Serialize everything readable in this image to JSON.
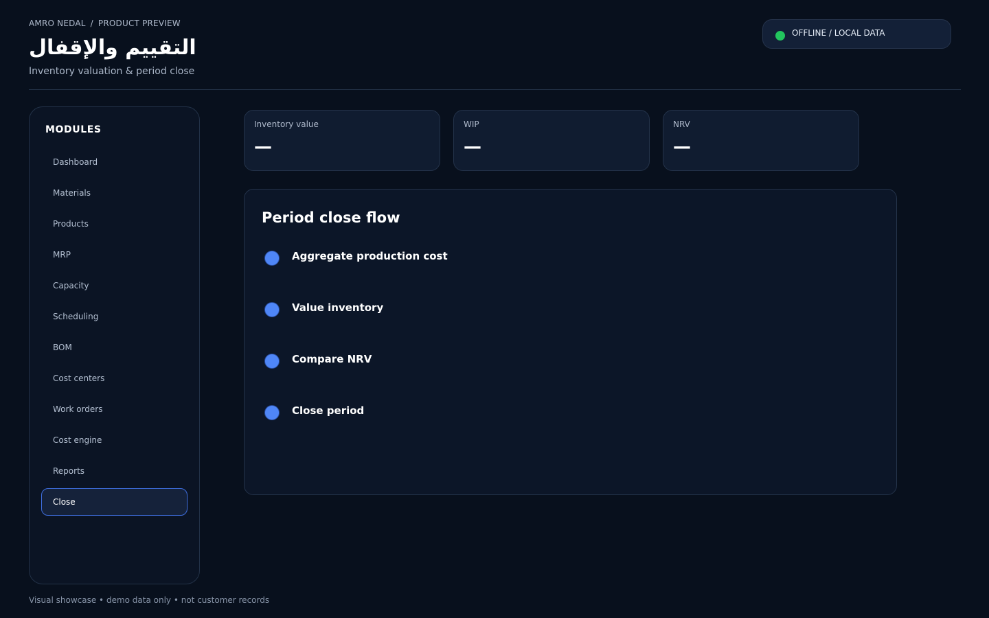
{
  "header": {
    "breadcrumb": [
      "AMRO NEDAL",
      "/",
      "PRODUCT PREVIEW"
    ],
    "title": "التقييم والإقفال",
    "subtitle": "Inventory valuation & period close",
    "status": {
      "label": "OFFLINE / LOCAL DATA",
      "color": "#22c55e"
    }
  },
  "sidebar": {
    "heading": "MODULES",
    "items": [
      {
        "label": "Dashboard",
        "active": false
      },
      {
        "label": "Materials",
        "active": false
      },
      {
        "label": "Products",
        "active": false
      },
      {
        "label": "MRP",
        "active": false
      },
      {
        "label": "Capacity",
        "active": false
      },
      {
        "label": "Scheduling",
        "active": false
      },
      {
        "label": "BOM",
        "active": false
      },
      {
        "label": "Cost centers",
        "active": false
      },
      {
        "label": "Work orders",
        "active": false
      },
      {
        "label": "Cost engine",
        "active": false
      },
      {
        "label": "Reports",
        "active": false
      },
      {
        "label": "Close",
        "active": true
      }
    ]
  },
  "kpis": [
    {
      "label": "Inventory value",
      "value": "—"
    },
    {
      "label": "WIP",
      "value": "—"
    },
    {
      "label": "NRV",
      "value": "—"
    }
  ],
  "flow": {
    "title": "Period close flow",
    "steps": [
      {
        "label": "Aggregate production cost"
      },
      {
        "label": "Value inventory"
      },
      {
        "label": "Compare NRV"
      },
      {
        "label": "Close period"
      }
    ]
  },
  "footer": {
    "note": "Visual showcase • demo data only • not customer records"
  },
  "colors": {
    "accent": "#4f86f7",
    "background": "#08101d",
    "active_border": "#3f6fe0"
  }
}
